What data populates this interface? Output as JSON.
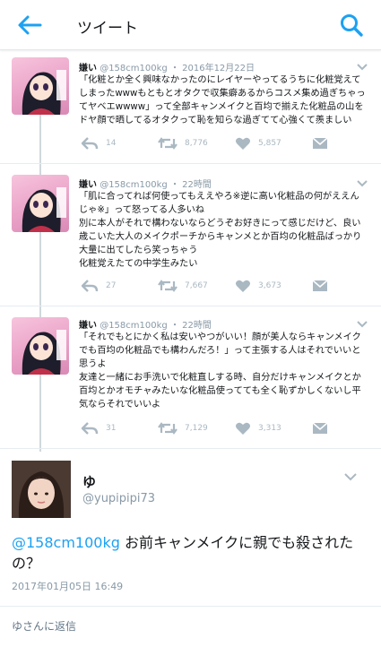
{
  "header": {
    "title": "ツイート"
  },
  "thread": [
    {
      "name": "嫌い",
      "handle": "@158cm100kg",
      "time": "2016年12月22日",
      "lines": [
        "「化粧とか全く興味なかったのにレイヤーやってるうちに化粧覚えて",
        "しまったwwwもともとオタクで収集癖あるからコスメ集め過ぎちゃっ",
        "てヤベエwwww」って全部キャンメイクと百均で揃えた化粧品の山を",
        "ドヤ顔で晒してるオタクって恥を知らな過ぎてて心強くて羨ましい"
      ],
      "replies": "14",
      "retweets": "8,776",
      "likes": "5,857"
    },
    {
      "name": "嫌い",
      "handle": "@158cm100kg",
      "time": "22時間",
      "lines": [
        "「肌に合ってれば何使ってもええやろ※逆に高い化粧品の何がええん",
        "じゃ※」って怒ってる人多いね",
        "別に本人がそれで構わないならどうぞお好きにって感じだけど、良い",
        "歳こいた大人のメイクポーチからキャンメとか百均の化粧品ばっかり",
        "大量に出てしたら笑っちゃう",
        "化粧覚えたての中学生みたい"
      ],
      "replies": "27",
      "retweets": "7,667",
      "likes": "3,673"
    },
    {
      "name": "嫌い",
      "handle": "@158cm100kg",
      "time": "22時間",
      "lines": [
        "「それでもとにかく私は安いやつがいい！顔が美人ならキャンメイク",
        "でも百均の化粧品でも構わんだろ！」って主張する人はそれでいいと",
        "思うよ",
        "友達と一緒にお手洗いで化粧直しする時、自分だけキャンメイクとか",
        "百均とかオモチャみたいな化粧品使ってても全く恥ずかしくないし平",
        "気ならそれでいいよ"
      ],
      "replies": "31",
      "retweets": "7,129",
      "likes": "3,313"
    }
  ],
  "main": {
    "name": "ゆ",
    "handle": "@yupipipi73",
    "mention": "@158cm100kg",
    "text_line1_rest": " お前キャンメイクに親でも殺された",
    "text_line2": "の？",
    "date": "2017年01月05日 16:49"
  },
  "reply_placeholder": "ゆさんに返信",
  "colors": {
    "accent": "#1da1f2",
    "muted": "#8899a6",
    "icon": "#aab8c2"
  }
}
